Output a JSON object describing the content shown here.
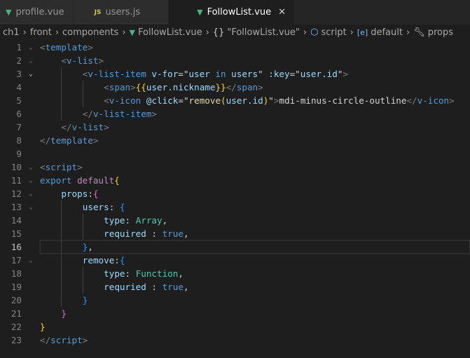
{
  "tabs": [
    {
      "label": "profile.vue",
      "icon": "vue-icon",
      "active": false
    },
    {
      "label": "users.js",
      "icon": "js-icon",
      "active": false
    },
    {
      "label": "FollowList.vue",
      "icon": "vue-icon",
      "active": true
    }
  ],
  "tab_close": "✕",
  "breadcrumbs": [
    "ch1",
    "front",
    "components",
    "FollowList.vue",
    "\"FollowList.vue\"",
    "script",
    "default",
    "props"
  ],
  "current_line": 16,
  "lines": [
    {
      "n": 1,
      "ind": 0,
      "fold": true,
      "tk": [
        [
          "<",
          "p"
        ],
        [
          "template",
          "t"
        ],
        [
          ">",
          "p"
        ]
      ]
    },
    {
      "n": 2,
      "ind": 1,
      "fold": true,
      "tk": [
        [
          "<",
          "p"
        ],
        [
          "v-list",
          "t"
        ],
        [
          ">",
          "p"
        ]
      ]
    },
    {
      "n": 3,
      "ind": 2,
      "fold": true,
      "hl": true,
      "tk": [
        [
          "<",
          "p"
        ],
        [
          "v-list-item",
          "t"
        ],
        [
          " ",
          "w"
        ],
        [
          "v-for",
          "a"
        ],
        [
          "=\"",
          "w"
        ],
        [
          "user",
          "a"
        ],
        [
          " in ",
          "k"
        ],
        [
          "users",
          "a"
        ],
        [
          "\" ",
          "w"
        ],
        [
          ":key",
          "a"
        ],
        [
          "=\"",
          "w"
        ],
        [
          "user.id",
          "a"
        ],
        [
          "\"",
          "w"
        ],
        [
          ">",
          "p"
        ]
      ]
    },
    {
      "n": 4,
      "ind": 3,
      "tk": [
        [
          "<",
          "p"
        ],
        [
          "span",
          "t"
        ],
        [
          ">",
          "p"
        ],
        [
          "{{",
          "b1"
        ],
        [
          "user.nickname",
          "a"
        ],
        [
          "}}",
          "b1"
        ],
        [
          "</",
          "p"
        ],
        [
          "span",
          "t"
        ],
        [
          ">",
          "p"
        ]
      ]
    },
    {
      "n": 5,
      "ind": 3,
      "tk": [
        [
          "<",
          "p"
        ],
        [
          "v-icon",
          "t"
        ],
        [
          " ",
          "w"
        ],
        [
          "@click",
          "a"
        ],
        [
          "=\"",
          "w"
        ],
        [
          "remove",
          "f"
        ],
        [
          "(",
          "b1"
        ],
        [
          "user.id",
          "a"
        ],
        [
          ")",
          "b1"
        ],
        [
          "\"",
          "w"
        ],
        [
          ">",
          "p"
        ],
        [
          "mdi-minus-circle-outline",
          "w"
        ],
        [
          "</",
          "p"
        ],
        [
          "v-icon",
          "t"
        ],
        [
          ">",
          "p"
        ]
      ]
    },
    {
      "n": 6,
      "ind": 2,
      "tk": [
        [
          "</",
          "p"
        ],
        [
          "v-list-item",
          "t"
        ],
        [
          ">",
          "p"
        ]
      ]
    },
    {
      "n": 7,
      "ind": 1,
      "tk": [
        [
          "</",
          "p"
        ],
        [
          "v-list",
          "t"
        ],
        [
          ">",
          "p"
        ]
      ]
    },
    {
      "n": 8,
      "ind": 0,
      "tk": [
        [
          "</",
          "p"
        ],
        [
          "template",
          "t"
        ],
        [
          ">",
          "p"
        ]
      ]
    },
    {
      "n": 9,
      "ind": 0,
      "tk": []
    },
    {
      "n": 10,
      "ind": 0,
      "fold": true,
      "tk": [
        [
          "<",
          "p"
        ],
        [
          "script",
          "t"
        ],
        [
          ">",
          "p"
        ]
      ]
    },
    {
      "n": 11,
      "ind": 0,
      "fold": true,
      "tk": [
        [
          "export",
          "k"
        ],
        [
          " ",
          "w"
        ],
        [
          "default",
          "c"
        ],
        [
          "{",
          "b1"
        ]
      ]
    },
    {
      "n": 12,
      "ind": 1,
      "fold": true,
      "tk": [
        [
          "props",
          "a"
        ],
        [
          ":",
          "w"
        ],
        [
          "{",
          "b2"
        ]
      ]
    },
    {
      "n": 13,
      "ind": 2,
      "fold": true,
      "tk": [
        [
          "users",
          "a"
        ],
        [
          ": ",
          "w"
        ],
        [
          "{",
          "b3"
        ]
      ]
    },
    {
      "n": 14,
      "ind": 3,
      "tk": [
        [
          "type",
          "a"
        ],
        [
          ": ",
          "w"
        ],
        [
          "Array",
          "y"
        ],
        [
          ",",
          "w"
        ]
      ]
    },
    {
      "n": 15,
      "ind": 3,
      "tk": [
        [
          "required",
          "a"
        ],
        [
          " : ",
          "w"
        ],
        [
          "true",
          "k"
        ],
        [
          ",",
          "w"
        ]
      ]
    },
    {
      "n": 16,
      "ind": 2,
      "tk": [
        [
          "}",
          "b3"
        ],
        [
          ",",
          "w"
        ]
      ]
    },
    {
      "n": 17,
      "ind": 2,
      "fold": true,
      "tk": [
        [
          "remove",
          "a"
        ],
        [
          ":",
          "w"
        ],
        [
          "{",
          "b3"
        ]
      ]
    },
    {
      "n": 18,
      "ind": 3,
      "tk": [
        [
          "type",
          "a"
        ],
        [
          ": ",
          "w"
        ],
        [
          "Function",
          "y"
        ],
        [
          ",",
          "w"
        ]
      ]
    },
    {
      "n": 19,
      "ind": 3,
      "tk": [
        [
          "requried",
          "a"
        ],
        [
          " : ",
          "w"
        ],
        [
          "true",
          "k"
        ],
        [
          ",",
          "w"
        ]
      ]
    },
    {
      "n": 20,
      "ind": 2,
      "tk": [
        [
          "}",
          "b3"
        ]
      ]
    },
    {
      "n": 21,
      "ind": 1,
      "tk": [
        [
          "}",
          "b2"
        ]
      ]
    },
    {
      "n": 22,
      "ind": 0,
      "tk": [
        [
          "}",
          "b1"
        ]
      ]
    },
    {
      "n": 23,
      "ind": 0,
      "tk": [
        [
          "</",
          "p"
        ],
        [
          "script",
          "t"
        ],
        [
          ">",
          "p"
        ]
      ]
    }
  ]
}
